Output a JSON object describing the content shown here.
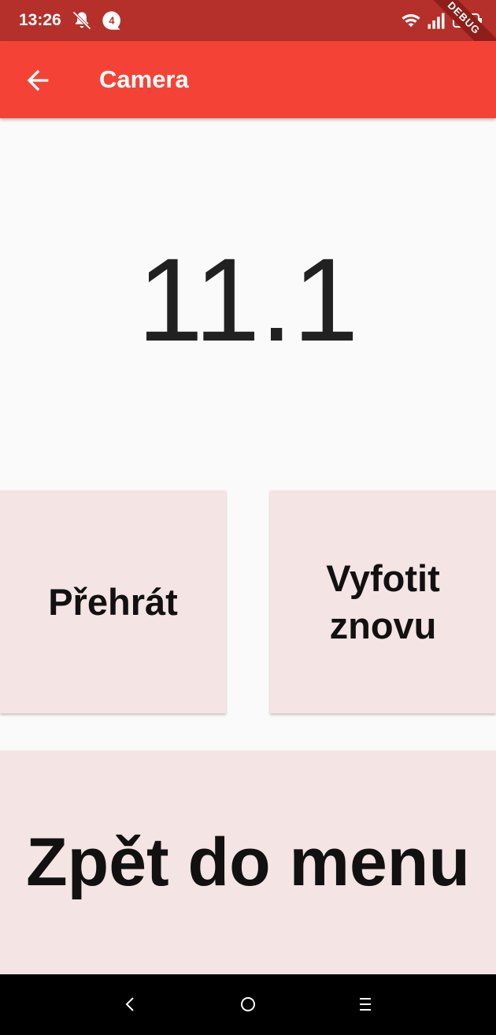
{
  "status_bar": {
    "time": "13:26",
    "notification_count": "4",
    "battery": "71",
    "debug_label": "DEBUG"
  },
  "app_bar": {
    "title": "Camera"
  },
  "main": {
    "timer_value": "11.1",
    "play_label": "Přehrát",
    "retake_label": "Vyfotit znovu",
    "menu_label": "Zpět do menu"
  },
  "colors": {
    "status_bar": "#b5302a",
    "app_bar": "#f44336",
    "tile": "#f5e4e4",
    "background": "#fafafa"
  }
}
